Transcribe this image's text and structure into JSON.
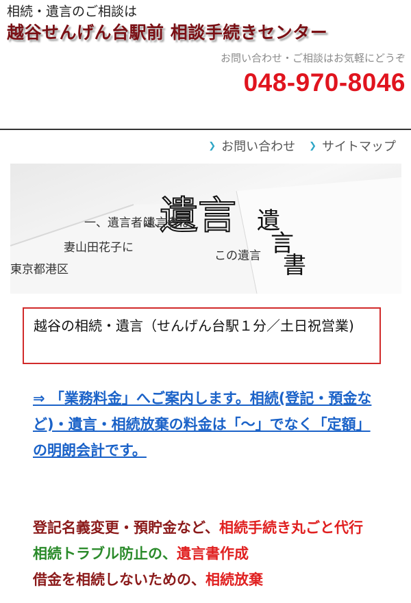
{
  "header": {
    "tagline": "相続・遺言のご相談は",
    "site_title": "越谷せんげん台駅前 相談手続きセンター",
    "contact_note": "お問い合わせ・ご相談はお気軽にどうぞ",
    "phone": "048-970-8046"
  },
  "subnav": {
    "items": [
      {
        "label": "お問い合わせ",
        "icon": "chevron-right-icon"
      },
      {
        "label": "サイトマップ",
        "icon": "chevron-right-icon"
      }
    ]
  },
  "hero": {
    "big_title": "遺言",
    "doc_title": "遺言書",
    "doc_lines": [
      "一、遺言者は、そ",
      "妻山田花子に",
      "東京都港区",
      "遺言者は",
      "この遺言"
    ]
  },
  "notice": {
    "text": "越谷の相続・遺言（せんげん台駅１分／土日祝営業)"
  },
  "promo": {
    "text": "⇒ 「業務料金」へご案内します。相続(登記・預金など)・遺言・相続放棄の料金は「〜」でなく「定額」の明朗会計です。"
  },
  "services": {
    "line1_prefix": "登記名義変更・預貯金など、",
    "line1_highlight": "相続手続き丸ごと代行",
    "line2_prefix": "相続トラブル防止の、",
    "line2_highlight": "遺言書作成",
    "line3_prefix": "借金を相続しないための、",
    "line3_highlight": "相続放棄"
  },
  "colors": {
    "title": "#7a0f14",
    "phone": "#e0141e",
    "link": "#1a62c8",
    "notice_border": "#d12a2a",
    "green": "#2a8a2a"
  }
}
